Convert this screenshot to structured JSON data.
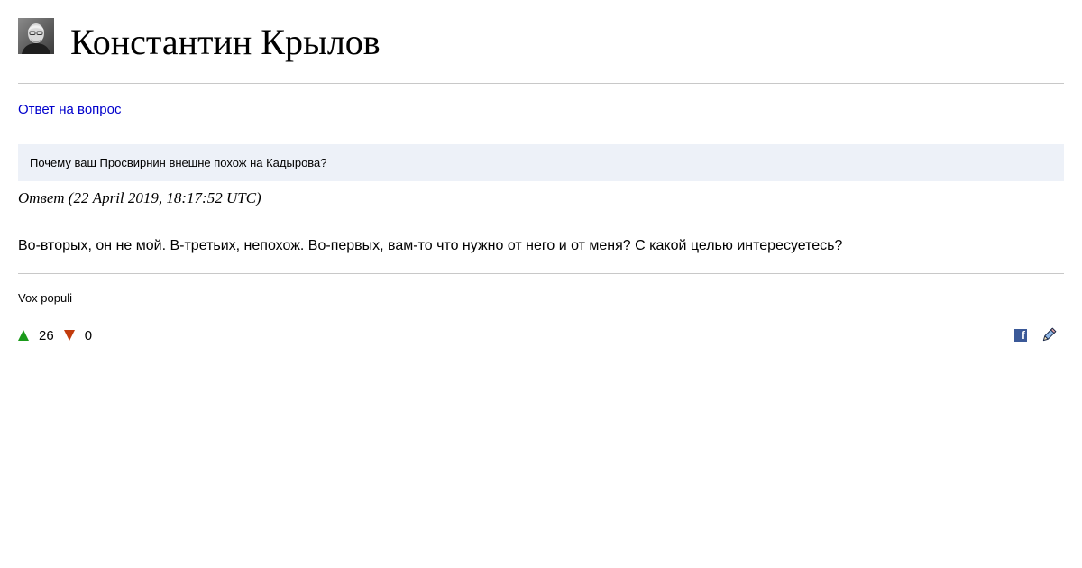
{
  "header": {
    "profile_name": "Константин Крылов",
    "avatar": "author-photo"
  },
  "nav": {
    "answer_link": "Ответ на вопрос"
  },
  "question": {
    "text": "Почему ваш Просвирнин внешне похож на Кадырова?"
  },
  "answer": {
    "meta": "Ответ (22 April 2019, 18:17:52 UTC)",
    "text": "Во-вторых, он не мой. В-третьих, непохож. Во-первых, вам-то что нужно от него и от меня? С какой целью интересуетесь?"
  },
  "footer": {
    "community": "Vox populi",
    "votes_up": "26",
    "votes_down": "0",
    "icons": {
      "upvote": "triangle-up-icon",
      "downvote": "triangle-down-icon",
      "share": "facebook-icon",
      "edit": "pencil-icon"
    }
  },
  "colors": {
    "link": "#0000cc",
    "question_bg": "#edf1f8",
    "divider": "#c8c8c8",
    "upvote": "#1a9a1a",
    "downvote": "#c23b0c",
    "facebook": "#3b5998"
  }
}
